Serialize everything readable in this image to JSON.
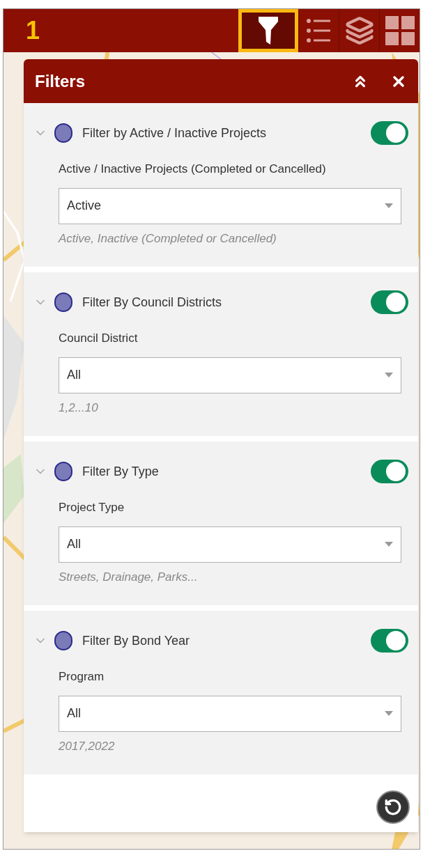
{
  "toolbar": {
    "annotation": "1",
    "tools": [
      {
        "kind": "filter",
        "selected": true,
        "highlighted": true
      },
      {
        "kind": "list",
        "selected": false,
        "highlighted": false
      },
      {
        "kind": "layers",
        "selected": false,
        "highlighted": false
      },
      {
        "kind": "grid",
        "selected": false,
        "highlighted": false
      }
    ]
  },
  "panel": {
    "title": "Filters",
    "filters": [
      {
        "title": "Filter by Active / Inactive Projects",
        "on": true,
        "expanded": true,
        "field_label": "Active / Inactive Projects (Completed or Cancelled)",
        "value": "Active",
        "hint": "Active, Inactive (Completed or Cancelled)"
      },
      {
        "title": "Filter By Council Districts",
        "on": true,
        "expanded": true,
        "field_label": "Council District",
        "value": "All",
        "hint": "1,2...10"
      },
      {
        "title": "Filter By Type",
        "on": true,
        "expanded": true,
        "field_label": "Project Type",
        "value": "All",
        "hint": "Streets, Drainage, Parks..."
      },
      {
        "title": "Filter By Bond Year",
        "on": true,
        "expanded": true,
        "field_label": "Program",
        "value": "All",
        "hint": "2017,2022"
      }
    ]
  }
}
